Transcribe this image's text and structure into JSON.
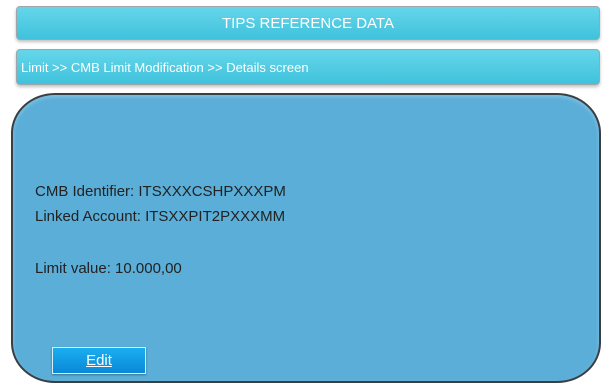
{
  "header": {
    "title": "TIPS REFERENCE DATA"
  },
  "breadcrumb": {
    "text": "Limit >> CMB Limit Modification >> Details screen"
  },
  "details": {
    "cmb_identifier": "CMB Identifier: ITSXXXCSHPXXXPM",
    "linked_account": "Linked Account: ITSXXPIT2PXXXMM",
    "limit_value": "Limit value: 10.000,00"
  },
  "actions": {
    "edit_label": "Edit"
  },
  "colors": {
    "bar_accent": "#4fcbe2",
    "panel_background": "#5aaed8",
    "button_background": "#0f9ae6"
  }
}
